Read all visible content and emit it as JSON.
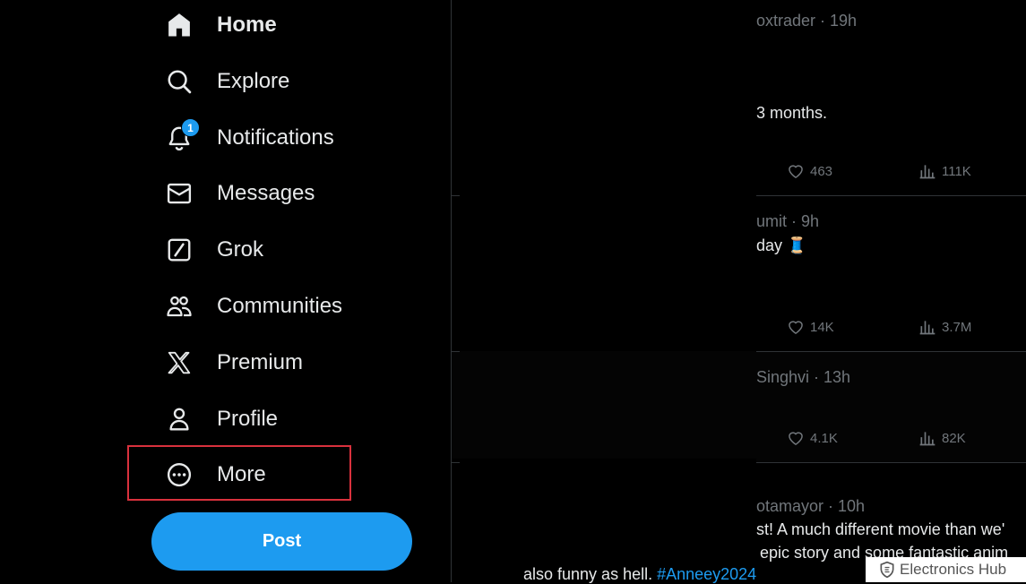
{
  "sidebar": {
    "items": [
      {
        "label": "Home",
        "icon": "home-icon"
      },
      {
        "label": "Explore",
        "icon": "search-icon"
      },
      {
        "label": "Notifications",
        "icon": "bell-icon",
        "badge": "1"
      },
      {
        "label": "Messages",
        "icon": "envelope-icon"
      },
      {
        "label": "Grok",
        "icon": "grok-icon"
      },
      {
        "label": "Communities",
        "icon": "people-icon"
      },
      {
        "label": "Premium",
        "icon": "x-logo-icon"
      },
      {
        "label": "Profile",
        "icon": "person-icon"
      },
      {
        "label": "More",
        "icon": "more-circle-icon"
      }
    ],
    "post_label": "Post"
  },
  "feed": {
    "tweets": [
      {
        "meta": "oxtrader · 19h",
        "text": "3 months.",
        "likes": "463",
        "views": "111K"
      },
      {
        "meta": "umit · 9h",
        "text": "day 🧵",
        "likes": "14K",
        "views": "3.7M"
      },
      {
        "meta": "Singhvi · 13h",
        "text": "",
        "likes": "4.1K",
        "views": "82K"
      },
      {
        "meta": "otamayor · 10h",
        "line1": "st! A much different movie than we'",
        "line2": "epic story and some fantastic anim",
        "line3_text": "also funny as hell. ",
        "line3_hashtag": "#Anneey2024"
      }
    ]
  },
  "watermark": "Electronics Hub",
  "colors": {
    "accent": "#1d9bf0",
    "highlight": "#d9313d",
    "background": "#000000",
    "muted": "#71767b"
  }
}
